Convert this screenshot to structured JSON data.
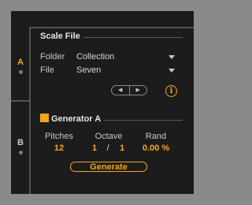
{
  "tabs": [
    {
      "label": "A",
      "selected": true
    },
    {
      "label": "B",
      "selected": false
    }
  ],
  "scale_file": {
    "title": "Scale File",
    "folder_label": "Folder",
    "folder_value": "Collection",
    "file_label": "File",
    "file_value": "Seven",
    "prev_icon": "triangle-left-icon",
    "next_icon": "triangle-right-icon",
    "info_icon": "info-icon",
    "info_glyph": "i"
  },
  "generator": {
    "title": "Generator A",
    "enabled": true,
    "pitches_label": "Pitches",
    "pitches_value": "12",
    "octave_label": "Octave",
    "octave_from": "1",
    "octave_sep": "/",
    "octave_to": "1",
    "rand_label": "Rand",
    "rand_value": "0.00 %",
    "generate_label": "Generate"
  },
  "colors": {
    "accent": "#f4a620",
    "panel": "#1c1c1c",
    "background": "#8a8a8a"
  }
}
